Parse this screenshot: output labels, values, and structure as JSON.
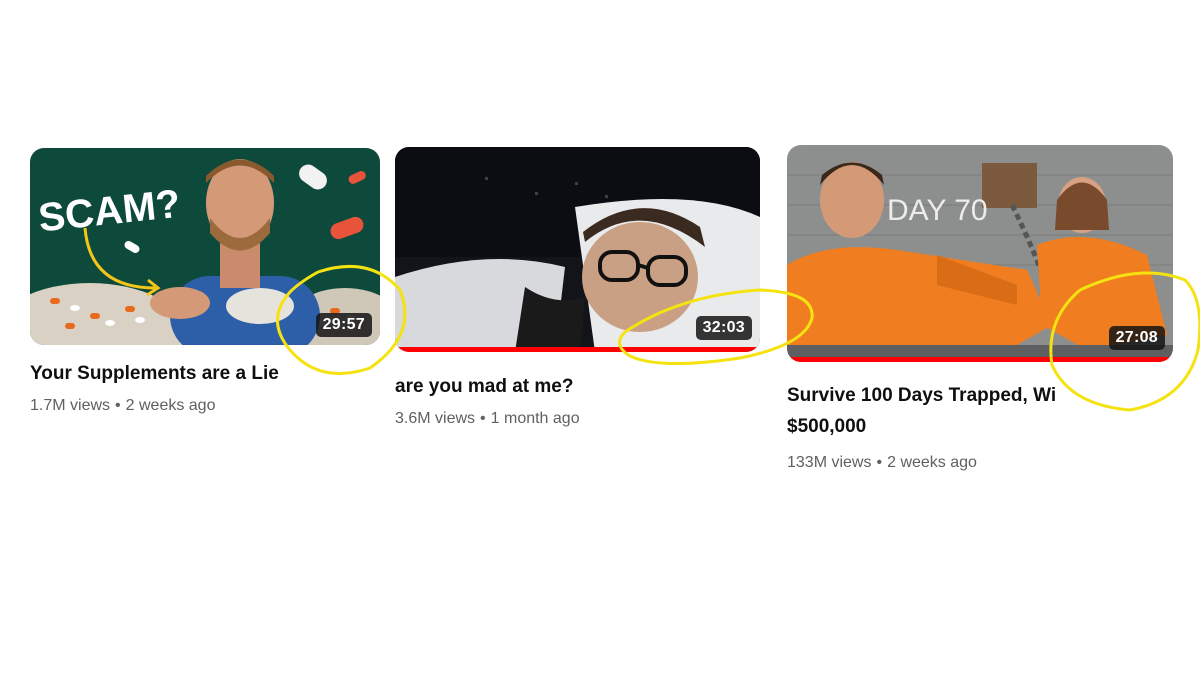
{
  "videos": [
    {
      "title": "Your Supplements are a Lie",
      "duration": "29:57",
      "views": "1.7M views",
      "age": "2 weeks ago",
      "thumb_text": "SCAM?",
      "watched_fraction": 0
    },
    {
      "title": "are you mad at me?",
      "duration": "32:03",
      "views": "3.6M views",
      "age": "1 month ago",
      "watched_fraction": 1.0
    },
    {
      "title_line1": "Survive 100 Days Trapped, Wi",
      "title_line2": "$500,000",
      "duration": "27:08",
      "views": "133M views",
      "age": "2 weeks ago",
      "thumb_text": "DAY 70",
      "watched_fraction": 1.0
    }
  ],
  "meta_separator": "•",
  "colors": {
    "progress": "#ff0000",
    "annotation": "#f5e211",
    "title": "#0f0f0f",
    "meta": "#606060"
  }
}
